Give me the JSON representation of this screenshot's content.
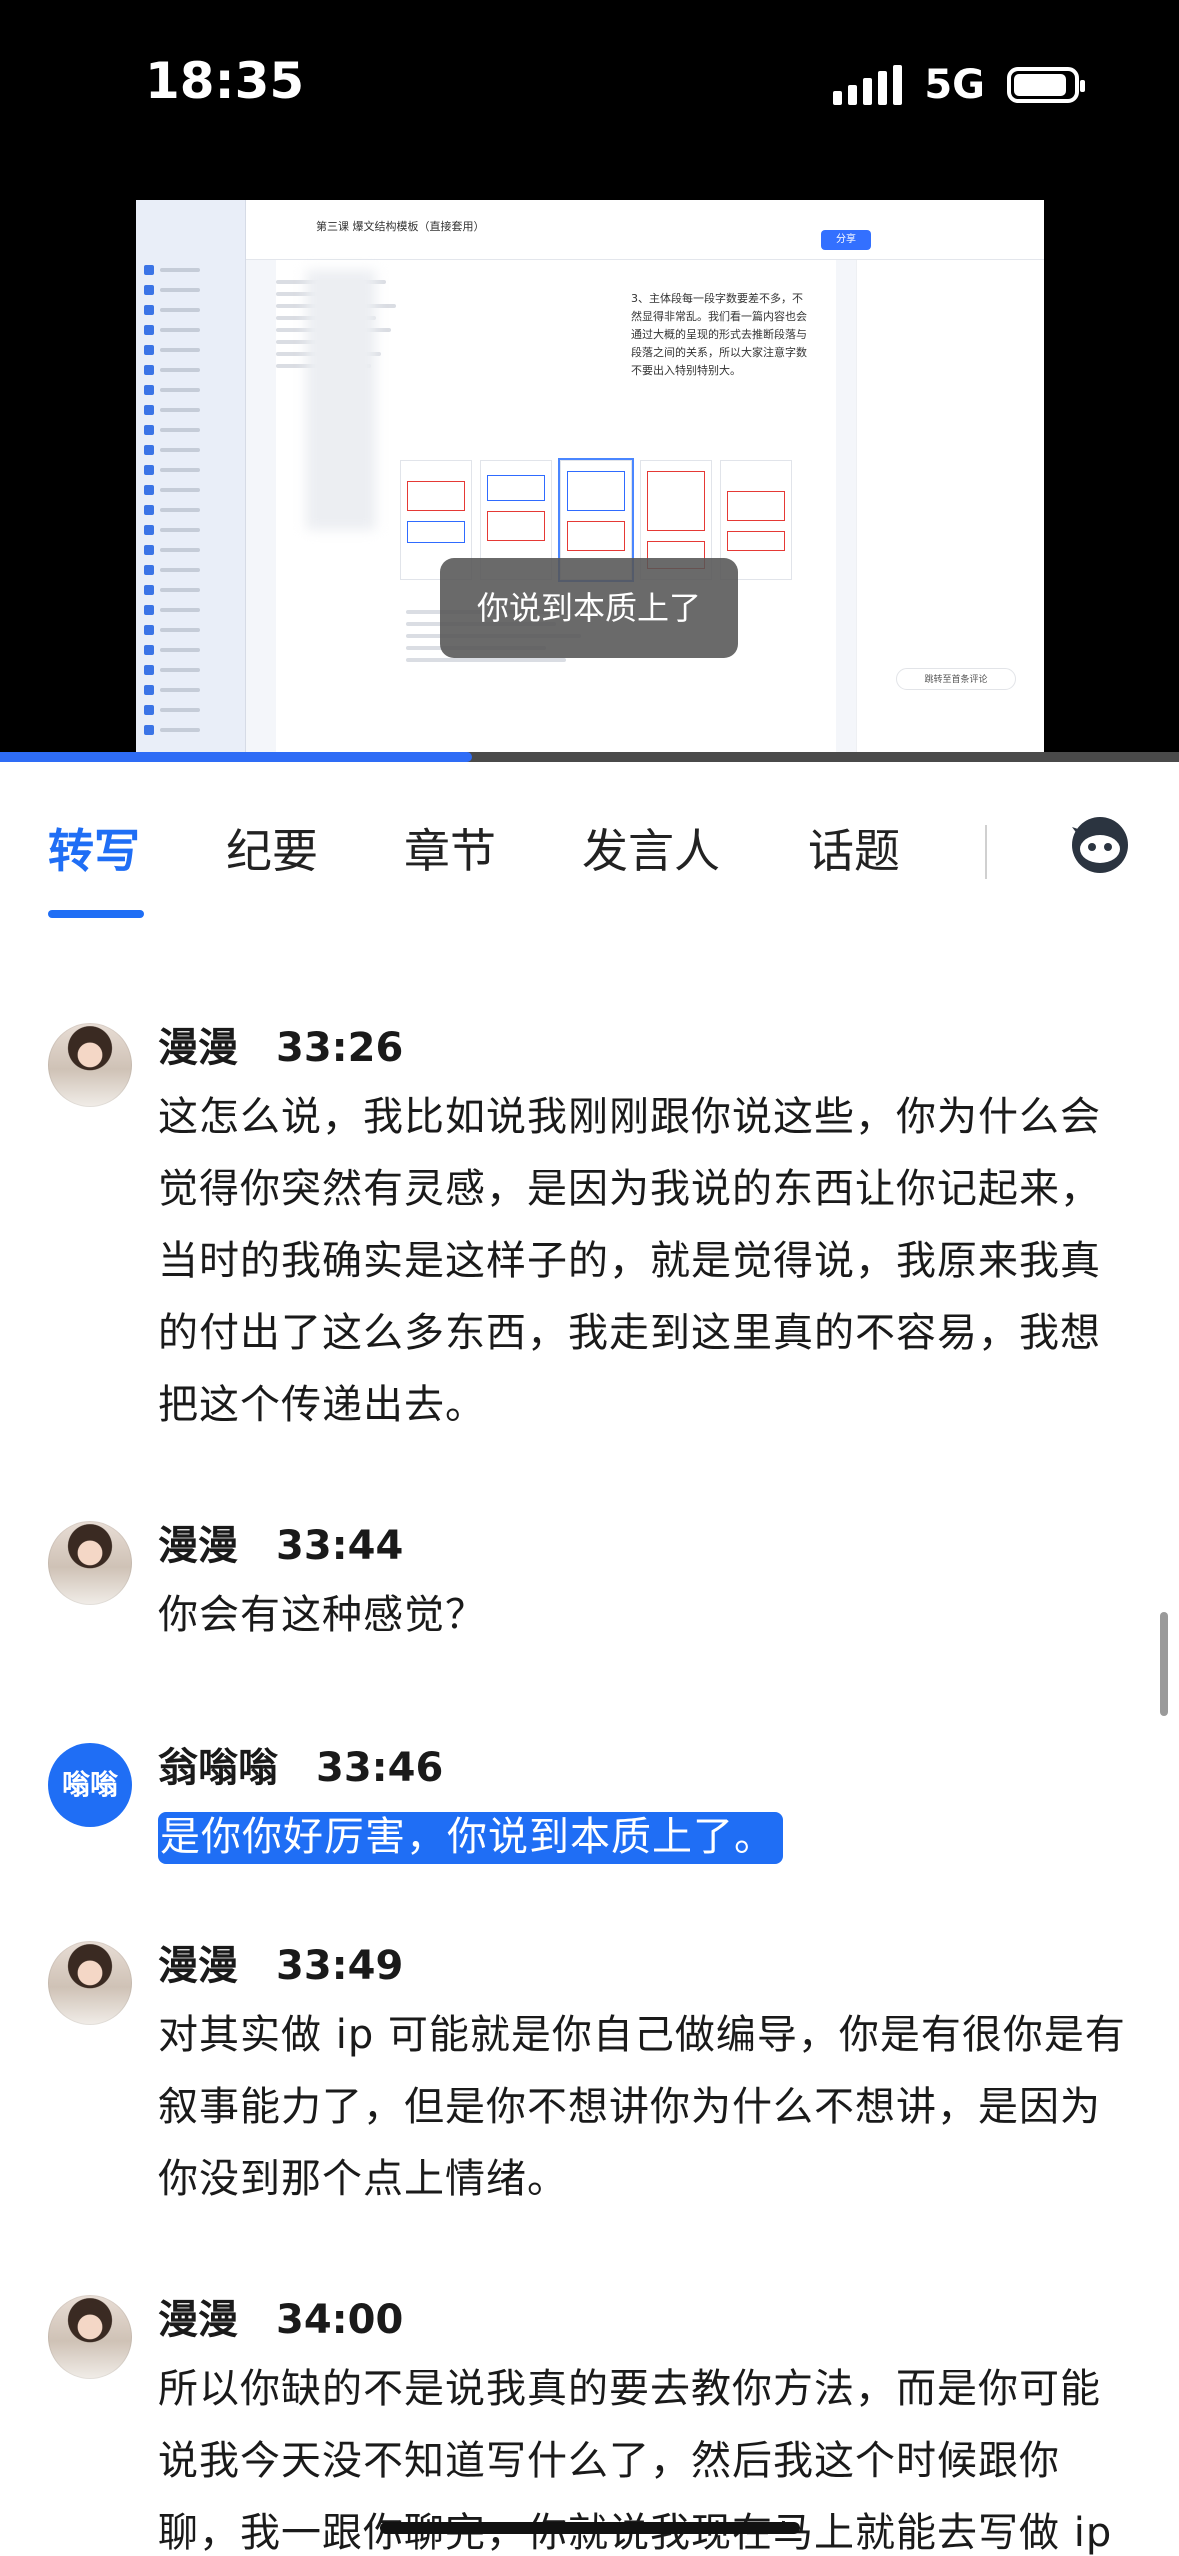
{
  "status_bar": {
    "time": "18:35",
    "network": "5G"
  },
  "video": {
    "subtitle": "你说到本质上了",
    "share_label": "分享",
    "breadcrumb": "第三课 爆文结构模板（直接套用）",
    "paragraph": "3、主体段每一段字数要差不多，不然显得非常乱。我们看一篇内容也会通过大概的呈现的形式去推断段落与段落之间的关系，所以大家注意字数不要出入特别特别大。",
    "jump_label": "跳转至首条评论",
    "progress_percent": 40
  },
  "tabs": [
    {
      "label": "转写",
      "active": true
    },
    {
      "label": "纪要",
      "active": false
    },
    {
      "label": "章节",
      "active": false
    },
    {
      "label": "发言人",
      "active": false
    },
    {
      "label": "话题",
      "active": false
    }
  ],
  "ai_icon": "assistant-bot-icon",
  "accent_color": "#1f6ef5",
  "transcript": [
    {
      "speaker": "漫漫",
      "time": "33:26",
      "avatar": "photo",
      "text": "这怎么说，我比如说我刚刚跟你说这些，你为什么会觉得你突然有灵感，是因为我说的东西让你记起来，当时的我确实是这样子的，就是觉得说，我原来我真的付出了这么多东西，我走到这里真的不容易，我想把这个传递出去。"
    },
    {
      "speaker": "漫漫",
      "time": "33:44",
      "avatar": "photo",
      "text": "你会有这种感觉？"
    },
    {
      "speaker": "翁嗡嗡",
      "time": "33:46",
      "avatar": "initials",
      "avatar_text": "嗡嗡",
      "text": "是你你好厉害，你说到本质上了。",
      "highlighted": true
    },
    {
      "speaker": "漫漫",
      "time": "33:49",
      "avatar": "photo",
      "text": "对其实做 ip 可能就是你自己做编导，你是有很你是有叙事能力了，但是你不想讲你为什么不想讲，是因为你没到那个点上情绪。"
    },
    {
      "speaker": "漫漫",
      "time": "34:00",
      "avatar": "photo",
      "text": "所以你缺的不是说我真的要去教你方法，而是你可能说我今天没不知道写什么了，然后我这个时候跟你聊，我一跟你聊完，你就说我现在马上就能去写做 ip"
    }
  ]
}
